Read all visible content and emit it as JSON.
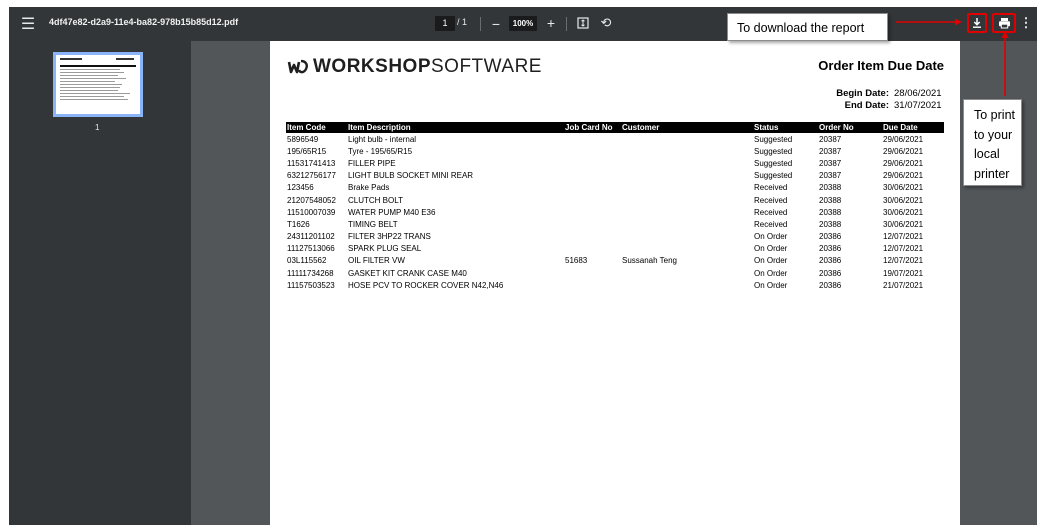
{
  "toolbar": {
    "file_name": "4df47e82-d2a9-11e4-ba82-978b15b85d12.pdf",
    "page_current": "1",
    "page_total": "/ 1",
    "zoom_out": "−",
    "zoom_value": "100%",
    "zoom_in": "+",
    "more": "⋮"
  },
  "sidebar": {
    "thumbnail_label": "1"
  },
  "document": {
    "logo_bold": "WORKSHOP",
    "logo_light": "SOFTWARE",
    "title": "Order Item Due Date",
    "begin_label": "Begin Date:",
    "begin_value": "28/06/2021",
    "end_label": "End Date:",
    "end_value": "31/07/2021",
    "columns": [
      "Item Code",
      "Item Description",
      "Job Card No",
      "Customer",
      "Status",
      "Order No",
      "Due Date"
    ],
    "rows": [
      [
        "5896549",
        "Light bulb - internal",
        "",
        "",
        "Suggested",
        "20387",
        "29/06/2021"
      ],
      [
        "195/65R15",
        "Tyre - 195/65/R15",
        "",
        "",
        "Suggested",
        "20387",
        "29/06/2021"
      ],
      [
        "11531741413",
        "FILLER PIPE",
        "",
        "",
        "Suggested",
        "20387",
        "29/06/2021"
      ],
      [
        "63212756177",
        "LIGHT BULB SOCKET MINI REAR",
        "",
        "",
        "Suggested",
        "20387",
        "29/06/2021"
      ],
      [
        "123456",
        "Brake Pads",
        "",
        "",
        "Received",
        "20388",
        "30/06/2021"
      ],
      [
        "21207548052",
        "CLUTCH BOLT",
        "",
        "",
        "Received",
        "20388",
        "30/06/2021"
      ],
      [
        "11510007039",
        "WATER PUMP M40 E36",
        "",
        "",
        "Received",
        "20388",
        "30/06/2021"
      ],
      [
        "T1626",
        "TIMING BELT",
        "",
        "",
        "Received",
        "20388",
        "30/06/2021"
      ],
      [
        "24311201102",
        "FILTER 3HP22 TRANS",
        "",
        "",
        "On Order",
        "20386",
        "12/07/2021"
      ],
      [
        "11127513066",
        "SPARK PLUG SEAL",
        "",
        "",
        "On Order",
        "20386",
        "12/07/2021"
      ],
      [
        "03L115562",
        "OIL FILTER VW",
        "51683",
        "Sussanah Teng",
        "On Order",
        "20386",
        "12/07/2021"
      ],
      [
        "11111734268",
        "GASKET KIT CRANK CASE M40",
        "",
        "",
        "On Order",
        "20386",
        "19/07/2021"
      ],
      [
        "11157503523",
        "HOSE PCV TO ROCKER COVER N42,N46",
        "",
        "",
        "On Order",
        "20386",
        "21/07/2021"
      ]
    ]
  },
  "annotations": {
    "download": "To download the report",
    "print_lines": [
      "To print",
      "to your",
      "local",
      "printer"
    ],
    "arrow_color": "#e00000"
  },
  "colors": {
    "toolbar_bg": "#323639",
    "viewer_bg": "#525659",
    "thumbnail_border": "#8ab4f8",
    "highlight": "#e00000"
  }
}
